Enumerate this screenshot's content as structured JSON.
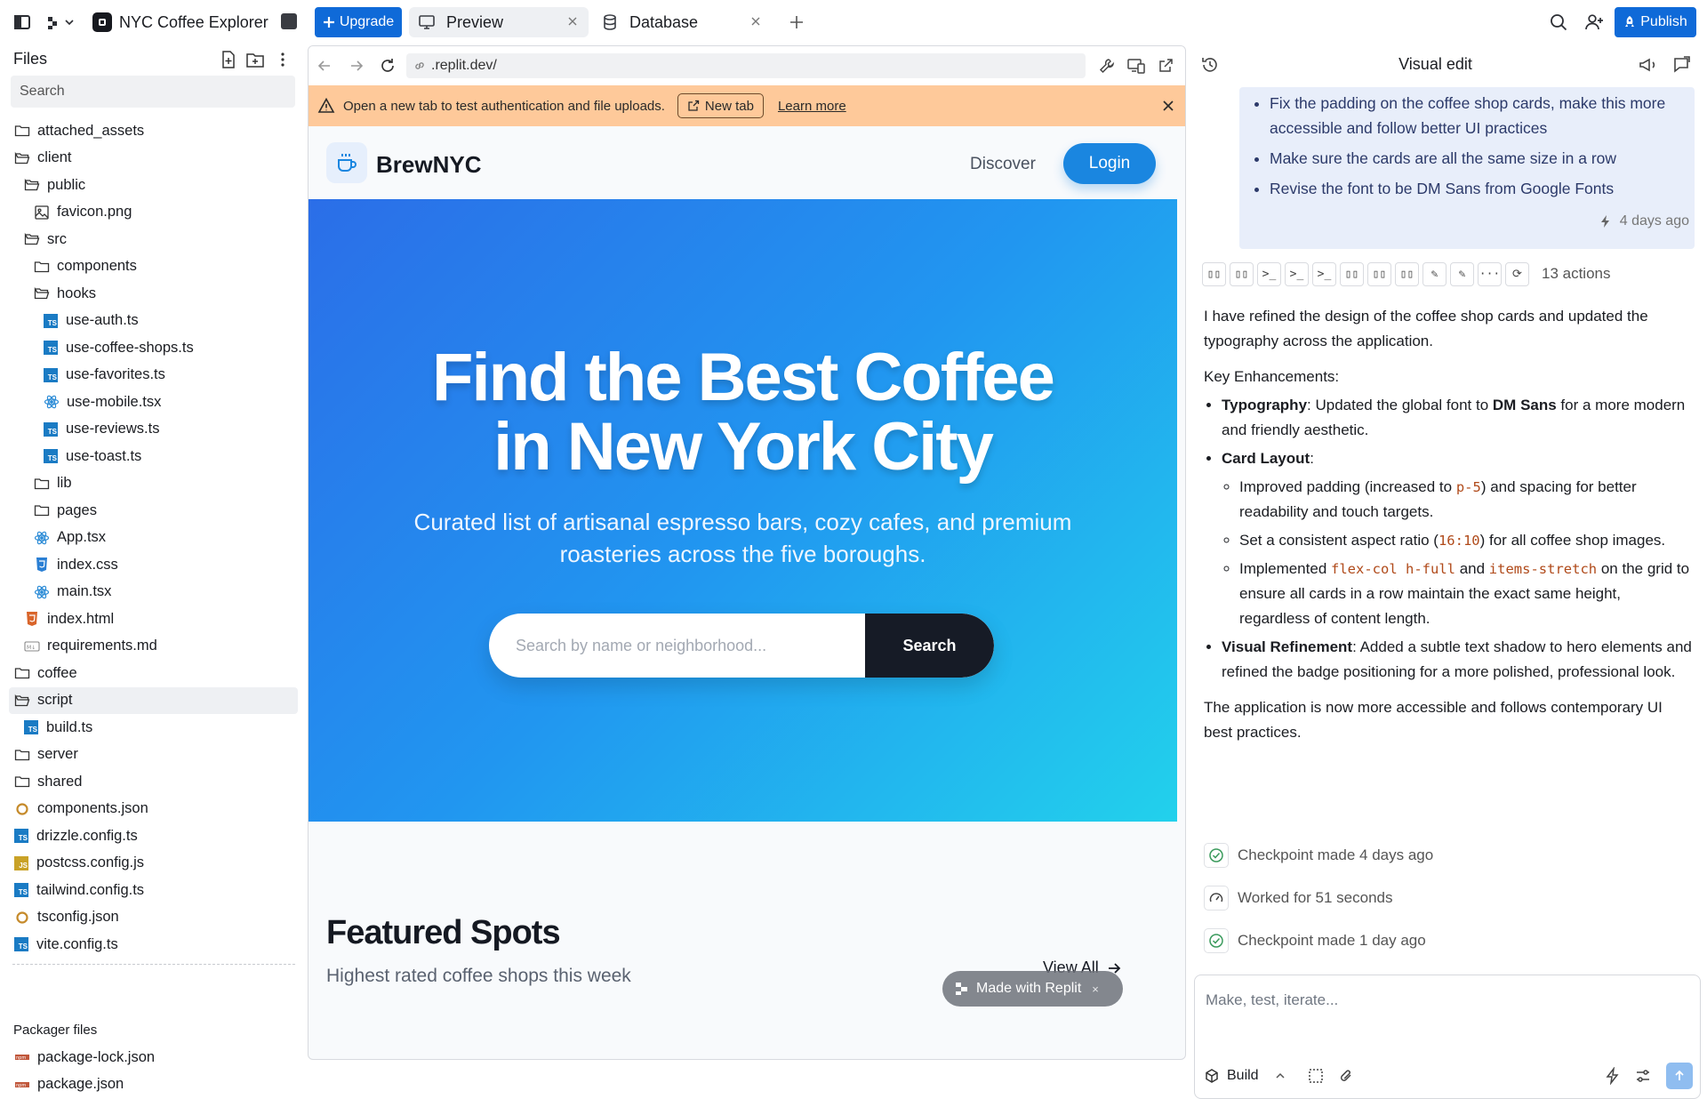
{
  "topbar": {
    "app_title": "NYC Coffee Explorer",
    "upgrade_label": "Upgrade",
    "tabs": [
      {
        "label": "Preview",
        "icon": "monitor-icon"
      },
      {
        "label": "Database",
        "icon": "database-icon"
      }
    ],
    "publish_label": "Publish"
  },
  "sidebar": {
    "title": "Files",
    "search_placeholder": "Search",
    "tree": [
      {
        "label": "attached_assets",
        "type": "folder"
      },
      {
        "label": "client",
        "type": "folder-open"
      },
      {
        "label": "public",
        "type": "folder-open"
      },
      {
        "label": "favicon.png",
        "type": "image"
      },
      {
        "label": "src",
        "type": "folder-open"
      },
      {
        "label": "components",
        "type": "folder"
      },
      {
        "label": "hooks",
        "type": "folder-open"
      },
      {
        "label": "use-auth.ts",
        "type": "ts"
      },
      {
        "label": "use-coffee-shops.ts",
        "type": "ts"
      },
      {
        "label": "use-favorites.ts",
        "type": "ts"
      },
      {
        "label": "use-mobile.tsx",
        "type": "react"
      },
      {
        "label": "use-reviews.ts",
        "type": "ts"
      },
      {
        "label": "use-toast.ts",
        "type": "ts"
      },
      {
        "label": "lib",
        "type": "folder"
      },
      {
        "label": "pages",
        "type": "folder"
      },
      {
        "label": "App.tsx",
        "type": "react"
      },
      {
        "label": "index.css",
        "type": "css"
      },
      {
        "label": "main.tsx",
        "type": "react"
      },
      {
        "label": "index.html",
        "type": "html"
      },
      {
        "label": "requirements.md",
        "type": "md"
      },
      {
        "label": "coffee",
        "type": "folder"
      },
      {
        "label": "script",
        "type": "folder-open"
      },
      {
        "label": "build.ts",
        "type": "ts"
      },
      {
        "label": "server",
        "type": "folder"
      },
      {
        "label": "shared",
        "type": "folder"
      },
      {
        "label": "components.json",
        "type": "json"
      },
      {
        "label": "drizzle.config.ts",
        "type": "ts"
      },
      {
        "label": "postcss.config.js",
        "type": "js"
      },
      {
        "label": "tailwind.config.ts",
        "type": "ts"
      },
      {
        "label": "tsconfig.json",
        "type": "json"
      },
      {
        "label": "vite.config.ts",
        "type": "ts"
      }
    ],
    "packager_title": "Packager files",
    "packager_files": [
      "package-lock.json",
      "package.json"
    ]
  },
  "preview": {
    "url": ".replit.dev/",
    "banner_text": "Open a new tab to test authentication and file uploads.",
    "new_tab_label": "New tab",
    "learn_more_label": "Learn more",
    "site": {
      "brand": "BrewNYC",
      "nav_discover": "Discover",
      "login_label": "Login",
      "hero_title_line1": "Find the Best Coffee",
      "hero_title_line2": "in New York City",
      "hero_subtitle": "Curated list of artisanal espresso bars, cozy cafes, and premium roasteries across the five boroughs.",
      "search_placeholder": "Search by name or neighborhood...",
      "search_button": "Search",
      "featured_title": "Featured Spots",
      "featured_subtitle": "Highest rated coffee shops this week",
      "view_all": "View All",
      "made_with": "Made with Replit"
    }
  },
  "chat": {
    "title": "Visual edit",
    "prompt_items": [
      "Fix the padding on the coffee shop cards, make this more accessible and follow better UI practices",
      "Make sure the cards are all the same size in a row",
      "Revise the font to be DM Sans from Google Fonts"
    ],
    "timestamp": "4 days ago",
    "actions_count": "13 actions",
    "message": {
      "intro": "I have refined the design of the coffee shop cards and updated the typography across the application.",
      "key_heading": "Key Enhancements:",
      "typo_label": "Typography",
      "typo_text_a": ": Updated the global font to ",
      "typo_font": "DM Sans",
      "typo_text_b": " for a more modern and friendly aesthetic.",
      "card_label": "Card Layout",
      "card_colon": ":",
      "card_item1_a": "Improved padding (increased to ",
      "card_item1_code": "p-5",
      "card_item1_b": ") and spacing for better readability and touch targets.",
      "card_item2_a": "Set a consistent aspect ratio (",
      "card_item2_code": "16:10",
      "card_item2_b": ") for all coffee shop images.",
      "card_item3_a": "Implemented ",
      "card_item3_code1": "flex-col h-full",
      "card_item3_mid": " and ",
      "card_item3_code2": "items-stretch",
      "card_item3_b": " on the grid to ensure all cards in a row maintain the exact same height, regardless of content length.",
      "visual_label": "Visual Refinement",
      "visual_text": ": Added a subtle text shadow to hero elements and refined the badge positioning for a more polished, professional look.",
      "outro": "The application is now more accessible and follows contemporary UI best practices."
    },
    "status_rows": [
      {
        "label": "Checkpoint made 4 days ago",
        "icon": "check-circle-icon"
      },
      {
        "label": "Worked for 51 seconds",
        "icon": "gauge-icon"
      },
      {
        "label": "Checkpoint made 1 day ago",
        "icon": "check-circle-icon"
      }
    ],
    "input_placeholder": "Make, test, iterate...",
    "build_label": "Build"
  },
  "colors": {
    "accent": "#0f6ad8",
    "banner": "#fec99a",
    "hero_start": "#2b6ee8",
    "hero_end": "#22d1ec"
  }
}
